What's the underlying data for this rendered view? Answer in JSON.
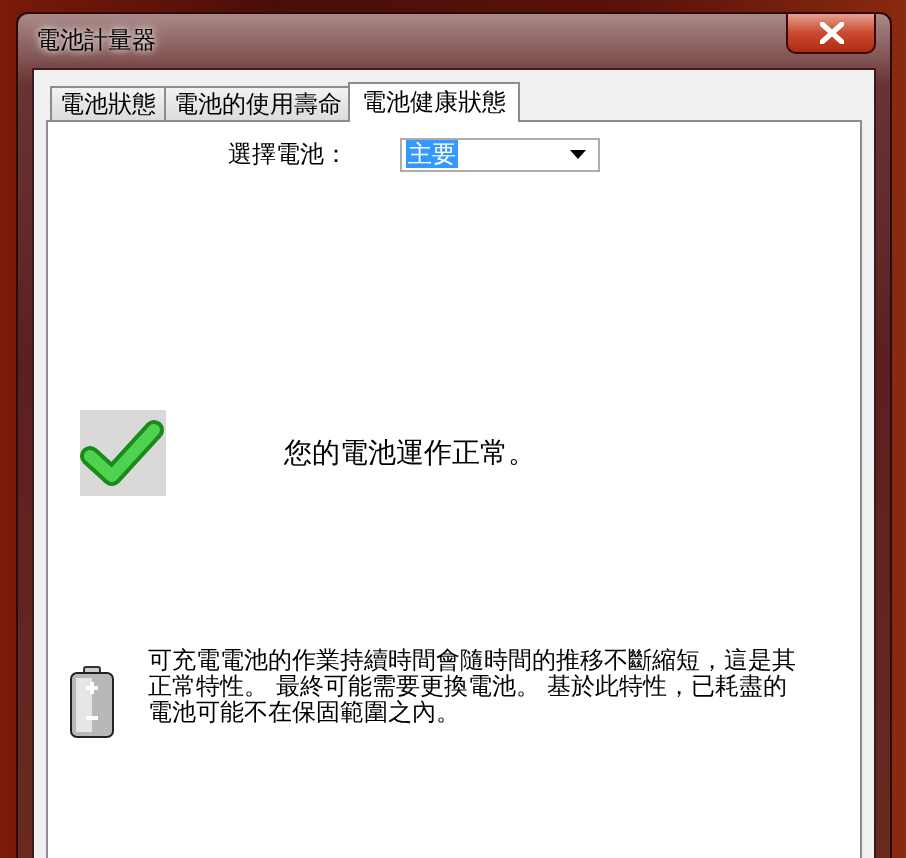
{
  "window": {
    "title": "電池計量器"
  },
  "tabs": [
    {
      "label": "電池狀態",
      "selected": false
    },
    {
      "label": "電池的使用壽命",
      "selected": false
    },
    {
      "label": "電池健康狀態",
      "selected": true
    }
  ],
  "battery_select": {
    "label": "選擇電池：",
    "value": "主要"
  },
  "status_message": "您的電池運作正常。",
  "info_text": "可充電電池的作業持續時間會隨時間的推移不斷縮短，這是其正常特性。 最終可能需要更換電池。 基於此特性，已耗盡的電池可能不在保固範圍之內。"
}
